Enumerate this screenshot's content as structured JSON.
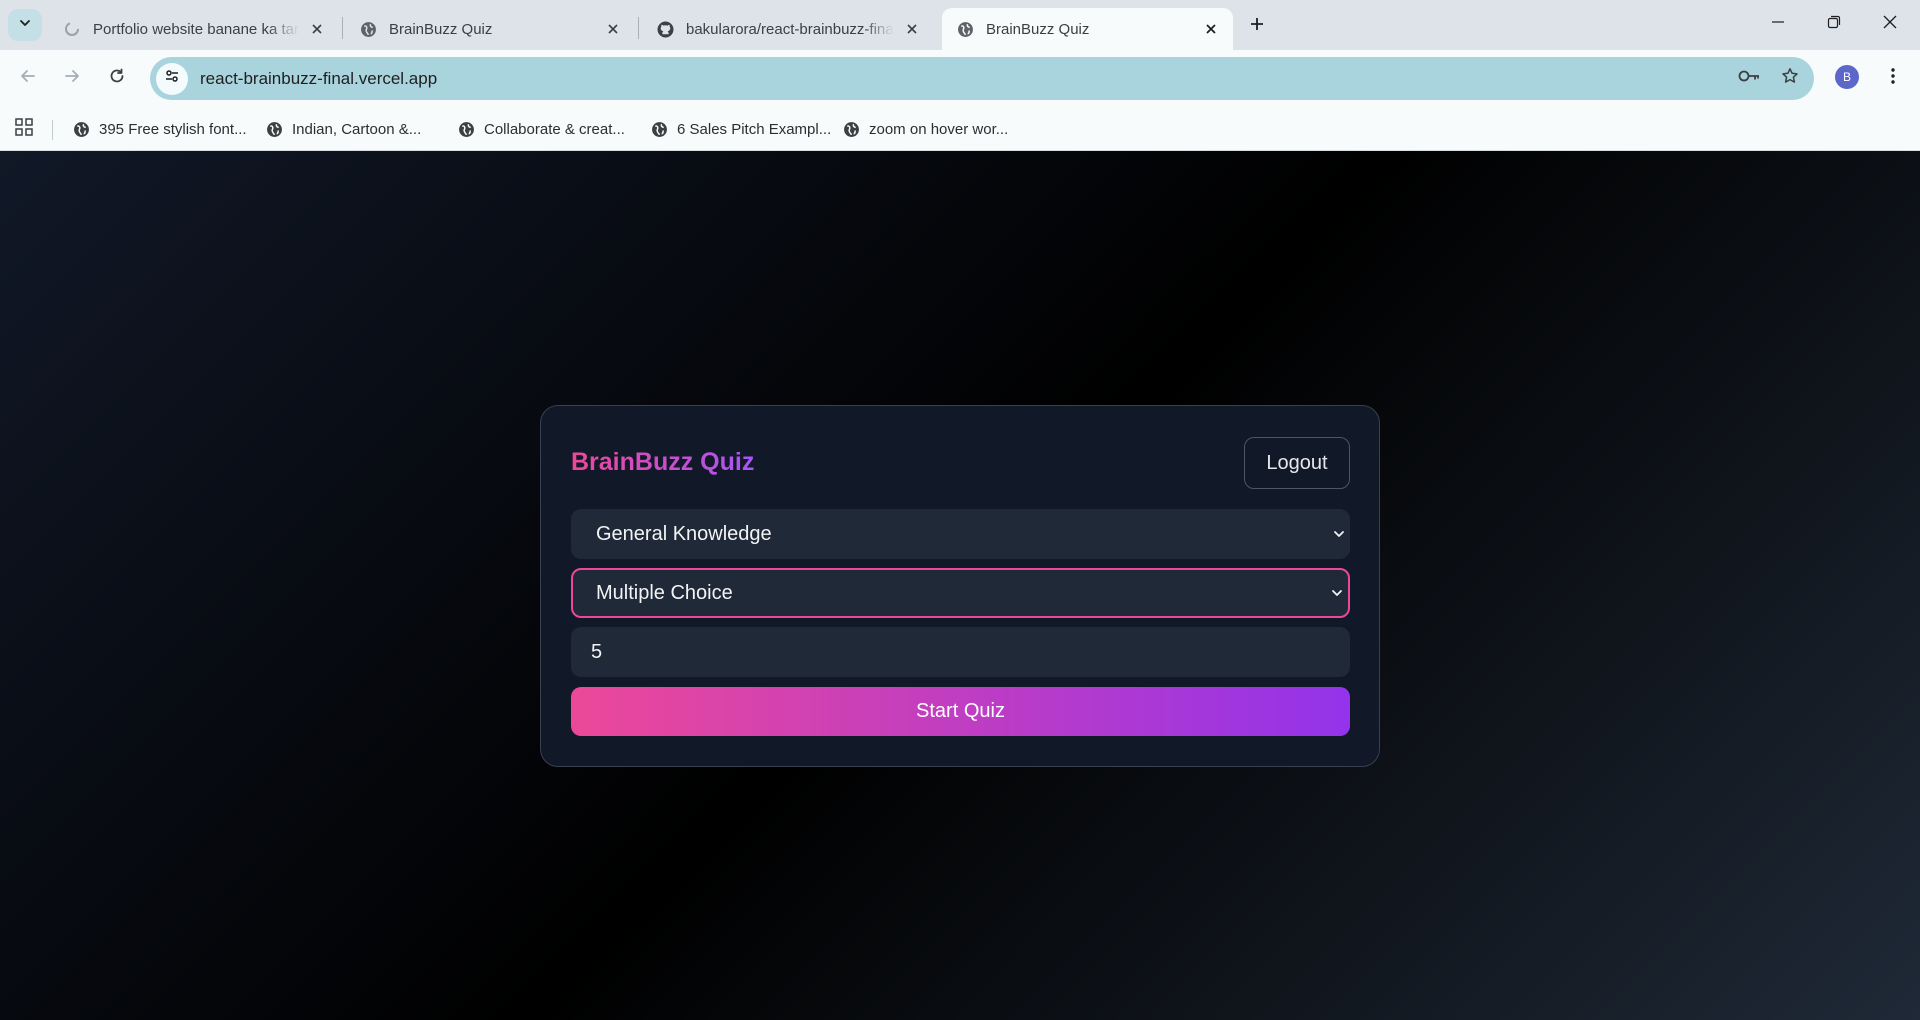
{
  "browser": {
    "tabs": [
      {
        "title": "Portfolio website banane ka tar",
        "favicon": "loading-icon",
        "active": false
      },
      {
        "title": "BrainBuzz Quiz",
        "favicon": "globe-icon",
        "active": false
      },
      {
        "title": "bakularora/react-brainbuzz-fina",
        "favicon": "github-icon",
        "active": false
      },
      {
        "title": "BrainBuzz Quiz",
        "favicon": "globe-icon",
        "active": true
      }
    ],
    "url": "react-brainbuzz-final.vercel.app",
    "profile_initial": "B",
    "bookmarks": [
      {
        "label": "395 Free stylish font..."
      },
      {
        "label": "Indian, Cartoon &..."
      },
      {
        "label": "Collaborate & creat..."
      },
      {
        "label": "6 Sales Pitch Exampl..."
      },
      {
        "label": "zoom on hover wor..."
      }
    ]
  },
  "quiz": {
    "title": "BrainBuzz Quiz",
    "logout_label": "Logout",
    "category_selected": "General Knowledge",
    "type_selected": "Multiple Choice",
    "question_count": "5",
    "start_label": "Start Quiz"
  },
  "colors": {
    "accent_pink": "#ec4899",
    "accent_purple": "#9333ea",
    "card_bg": "#111827",
    "field_bg": "#1f2937"
  }
}
